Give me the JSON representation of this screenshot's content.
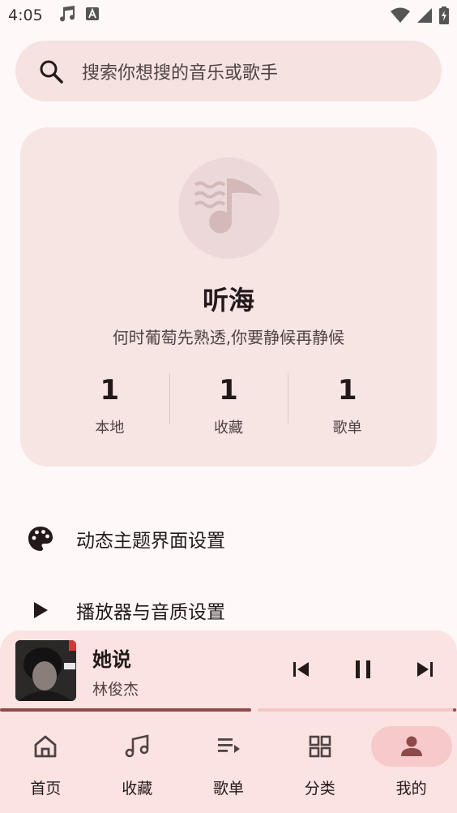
{
  "status_bar": {
    "time": "4:05"
  },
  "search": {
    "placeholder": "搜索你想搜的音乐或歌手"
  },
  "profile": {
    "name": "听海",
    "motto": "何时葡萄先熟透,你要静候再静候",
    "stats": [
      {
        "value": "1",
        "label": "本地"
      },
      {
        "value": "1",
        "label": "收藏"
      },
      {
        "value": "1",
        "label": "歌单"
      }
    ]
  },
  "menu": [
    {
      "label": "动态主题界面设置",
      "icon": "palette-icon"
    },
    {
      "label": "播放器与音质设置",
      "icon": "play-icon"
    }
  ],
  "player": {
    "title": "她说",
    "artist": "林俊杰",
    "progress": 0.55
  },
  "nav": [
    {
      "label": "首页",
      "icon": "home-icon",
      "active": false
    },
    {
      "label": "收藏",
      "icon": "music-notes-icon",
      "active": false
    },
    {
      "label": "歌单",
      "icon": "playlist-icon",
      "active": false
    },
    {
      "label": "分类",
      "icon": "grid-icon",
      "active": false
    },
    {
      "label": "我的",
      "icon": "person-icon",
      "active": true
    }
  ],
  "colors": {
    "background": "#fff8f8",
    "surface": "#f7e5e4",
    "accent": "#8e4a4a",
    "player_surface": "#fbe3e2",
    "active_indicator": "#f6caca"
  }
}
